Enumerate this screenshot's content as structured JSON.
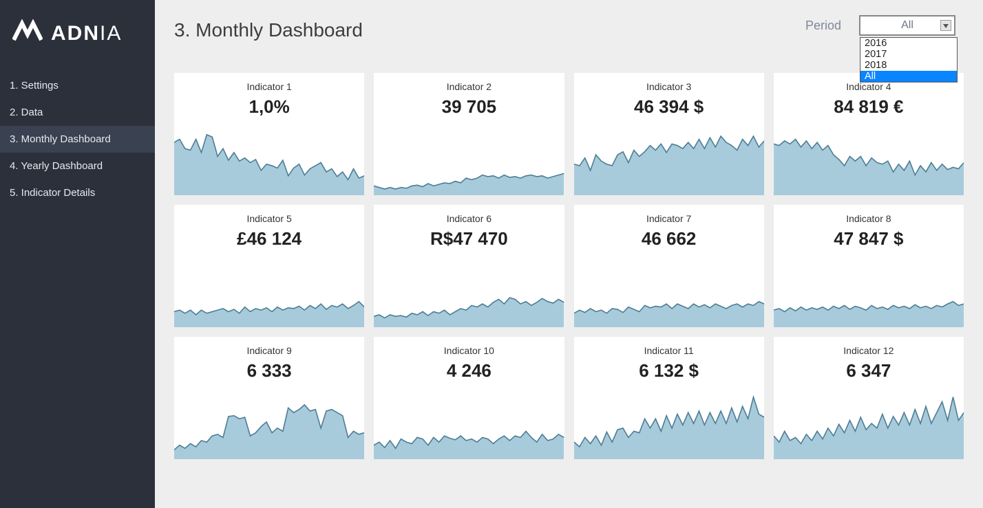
{
  "brand": {
    "name_bold": "ADN",
    "name_light": "IA"
  },
  "sidebar": {
    "items": [
      {
        "label": "1. Settings"
      },
      {
        "label": "2. Data"
      },
      {
        "label": "3. Monthly Dashboard",
        "active": true
      },
      {
        "label": "4. Yearly Dashboard"
      },
      {
        "label": "5. Indicator Details"
      }
    ]
  },
  "header": {
    "title": "3. Monthly Dashboard",
    "period_label": "Period",
    "period_value": "All",
    "period_options": [
      {
        "label": "2016"
      },
      {
        "label": "2017"
      },
      {
        "label": "2018"
      },
      {
        "label": "All",
        "selected": true
      }
    ]
  },
  "colors": {
    "chart_fill": "#a8cbdc",
    "chart_stroke": "#4e7e95",
    "sidebar_bg": "#2b303b",
    "sidebar_active": "#3a4150",
    "accent_dropdown": "#0a84ff"
  },
  "cards": [
    {
      "title": "Indicator 1",
      "value": "1,0%"
    },
    {
      "title": "Indicator 2",
      "value": "39 705"
    },
    {
      "title": "Indicator 3",
      "value": "46 394 $"
    },
    {
      "title": "Indicator 4",
      "value": "84 819 €"
    },
    {
      "title": "Indicator 5",
      "value": "£46 124"
    },
    {
      "title": "Indicator 6",
      "value": "R$47 470"
    },
    {
      "title": "Indicator 7",
      "value": "46 662"
    },
    {
      "title": "Indicator 8",
      "value": "47 847 $"
    },
    {
      "title": "Indicator 9",
      "value": "6 333"
    },
    {
      "title": "Indicator 10",
      "value": "4 246"
    },
    {
      "title": "Indicator 11",
      "value": "6 132 $"
    },
    {
      "title": "Indicator 12",
      "value": "6 347"
    }
  ],
  "chart_data": [
    {
      "type": "area",
      "title": "Indicator 1",
      "ylim": [
        0,
        100
      ],
      "values": [
        68,
        72,
        60,
        58,
        72,
        55,
        78,
        75,
        50,
        60,
        45,
        55,
        44,
        48,
        42,
        46,
        32,
        40,
        38,
        35,
        45,
        25,
        35,
        40,
        26,
        34,
        38,
        42,
        30,
        34,
        24,
        30,
        20,
        34,
        22,
        25
      ]
    },
    {
      "type": "area",
      "title": "Indicator 2",
      "ylim": [
        0,
        100
      ],
      "values": [
        12,
        10,
        8,
        10,
        8,
        10,
        9,
        12,
        13,
        11,
        15,
        12,
        14,
        16,
        15,
        18,
        16,
        22,
        20,
        22,
        26,
        24,
        25,
        22,
        26,
        23,
        24,
        22,
        25,
        26,
        24,
        25,
        22,
        24,
        26,
        28
      ]
    },
    {
      "type": "area",
      "title": "Indicator 3",
      "ylim": [
        0,
        100
      ],
      "values": [
        40,
        38,
        48,
        32,
        52,
        44,
        40,
        38,
        52,
        56,
        42,
        58,
        50,
        56,
        64,
        58,
        66,
        55,
        66,
        64,
        60,
        68,
        60,
        72,
        60,
        74,
        62,
        76,
        68,
        64,
        58,
        72,
        64,
        76,
        62,
        70
      ]
    },
    {
      "type": "area",
      "title": "Indicator 4",
      "ylim": [
        0,
        100
      ],
      "values": [
        66,
        64,
        70,
        66,
        72,
        62,
        70,
        60,
        68,
        58,
        64,
        52,
        46,
        38,
        50,
        44,
        50,
        38,
        48,
        42,
        40,
        44,
        30,
        40,
        32,
        44,
        26,
        38,
        30,
        42,
        32,
        40,
        33,
        36,
        34,
        42
      ]
    },
    {
      "type": "area",
      "title": "Indicator 5",
      "ylim": [
        0,
        100
      ],
      "values": [
        20,
        22,
        18,
        22,
        16,
        22,
        18,
        20,
        22,
        24,
        20,
        23,
        18,
        26,
        20,
        24,
        22,
        25,
        20,
        26,
        22,
        25,
        24,
        27,
        22,
        28,
        24,
        30,
        23,
        28,
        26,
        30,
        24,
        28,
        33,
        26
      ]
    },
    {
      "type": "area",
      "title": "Indicator 6",
      "ylim": [
        0,
        100
      ],
      "values": [
        14,
        16,
        12,
        16,
        14,
        15,
        13,
        18,
        16,
        20,
        15,
        20,
        18,
        22,
        16,
        20,
        24,
        22,
        28,
        26,
        30,
        26,
        32,
        36,
        30,
        38,
        36,
        30,
        33,
        28,
        32,
        37,
        33,
        31,
        36,
        32
      ]
    },
    {
      "type": "area",
      "title": "Indicator 7",
      "ylim": [
        0,
        100
      ],
      "values": [
        18,
        22,
        19,
        24,
        20,
        22,
        18,
        24,
        23,
        19,
        26,
        23,
        20,
        28,
        25,
        27,
        26,
        30,
        24,
        30,
        27,
        24,
        30,
        26,
        29,
        25,
        30,
        27,
        24,
        28,
        30,
        26,
        30,
        28,
        33,
        30
      ]
    },
    {
      "type": "area",
      "title": "Indicator 8",
      "ylim": [
        0,
        100
      ],
      "values": [
        22,
        24,
        20,
        25,
        21,
        26,
        22,
        25,
        23,
        26,
        22,
        27,
        24,
        28,
        23,
        27,
        25,
        22,
        28,
        24,
        26,
        23,
        28,
        25,
        27,
        24,
        29,
        25,
        27,
        24,
        28,
        26,
        30,
        33,
        28,
        30
      ]
    },
    {
      "type": "area",
      "title": "Indicator 9",
      "ylim": [
        0,
        100
      ],
      "values": [
        12,
        18,
        14,
        20,
        16,
        24,
        22,
        30,
        32,
        28,
        55,
        56,
        52,
        54,
        30,
        34,
        42,
        48,
        34,
        40,
        36,
        66,
        60,
        64,
        70,
        62,
        64,
        40,
        62,
        64,
        60,
        56,
        28,
        36,
        32,
        34
      ]
    },
    {
      "type": "area",
      "title": "Indicator 10",
      "ylim": [
        0,
        100
      ],
      "values": [
        18,
        22,
        15,
        24,
        14,
        26,
        22,
        20,
        28,
        26,
        18,
        28,
        22,
        30,
        27,
        25,
        30,
        24,
        26,
        22,
        28,
        26,
        20,
        26,
        30,
        24,
        30,
        28,
        36,
        28,
        22,
        32,
        24,
        26,
        32,
        28
      ]
    },
    {
      "type": "area",
      "title": "Indicator 11",
      "ylim": [
        0,
        100
      ],
      "values": [
        22,
        16,
        28,
        20,
        30,
        18,
        35,
        22,
        38,
        40,
        28,
        36,
        34,
        52,
        40,
        52,
        36,
        56,
        40,
        58,
        44,
        60,
        46,
        62,
        44,
        60,
        46,
        62,
        46,
        66,
        48,
        68,
        52,
        80,
        58,
        54
      ]
    },
    {
      "type": "area",
      "title": "Indicator 12",
      "ylim": [
        0,
        100
      ],
      "values": [
        30,
        22,
        36,
        24,
        28,
        20,
        32,
        24,
        36,
        26,
        40,
        30,
        45,
        34,
        50,
        36,
        54,
        38,
        46,
        40,
        58,
        40,
        55,
        44,
        60,
        44,
        64,
        46,
        68,
        46,
        60,
        74,
        50,
        80,
        50,
        60
      ]
    }
  ]
}
